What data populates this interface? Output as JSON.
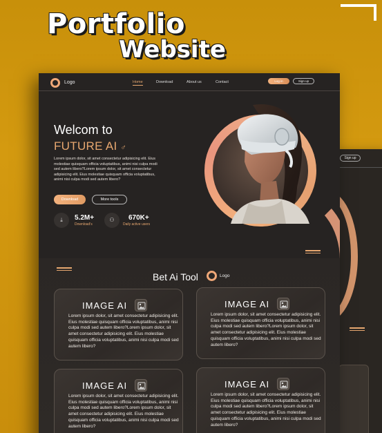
{
  "promo": {
    "title": "Portfolio",
    "subtitle": "Website"
  },
  "nav": {
    "logo": "Logo",
    "links": [
      "Home",
      "Download",
      "About us",
      "Contact"
    ],
    "login": "Log in",
    "signup": "Sign up"
  },
  "hero": {
    "title": "Welcom to",
    "accent": "FUTURE AI",
    "accent_symbol": "♂",
    "body": "Lorem ipsum dolor, sit amet consectetur adipisicing elit. Eius molestiae quisquam officia voluptatibus, animi nisi culpa modi sed autem libero?Lorem ipsum dolor, sit amet consectetur adipisicing elit. Eius molestiae quisquam officia voluptatibus, animi nisi culpa modi sed autem libero?",
    "download": "Download",
    "more": "More tools",
    "stats": [
      {
        "value": "5.2M+",
        "label": "Download's",
        "icon": "download-box-icon"
      },
      {
        "value": "670K+",
        "label": "Daily active users",
        "icon": "users-icon"
      }
    ]
  },
  "section": {
    "title": "Bet Ai Tool",
    "logo": "Logo"
  },
  "cards": [
    {
      "title": "IMAGE  AI",
      "body": "Lorem ipsum dolor, sit amet consectetur adipisicing elit. Eius molestiae quisquam officia voluptatibus, animi nisi culpa modi sed autem libero?Lorem ipsum dolor, sit amet consectetur adipisicing elit. Eius molestiae quisquam officia voluptatibus, animi nisi culpa modi sed autem libero?"
    },
    {
      "title": "IMAGE  AI",
      "body": "Lorem ipsum dolor, sit amet consectetur adipisicing elit. Eius molestiae quisquam officia voluptatibus, animi nisi culpa modi sed autem libero?Lorem ipsum dolor, sit amet consectetur adipisicing elit. Eius molestiae quisquam officia voluptatibus, animi nisi culpa modi sed autem libero?"
    },
    {
      "title": "IMAGE  AI",
      "body": "Lorem ipsum dolor, sit amet consectetur adipisicing elit. Eius molestiae quisquam officia voluptatibus, animi nisi culpa modi sed autem libero?Lorem ipsum dolor, sit amet consectetur adipisicing elit. Eius molestiae quisquam officia voluptatibus, animi nisi culpa modi sed autem libero?"
    },
    {
      "title": "IMAGE  AI",
      "body": "Lorem ipsum dolor, sit amet consectetur adipisicing elit. Eius molestiae quisquam officia voluptatibus, animi nisi culpa modi sed autem libero?Lorem ipsum dolor, sit amet consectetur adipisicing elit. Eius molestiae quisquam officia voluptatibus, animi nisi culpa modi sed autem libero?"
    }
  ],
  "back_page": {
    "signup": "Sign up"
  },
  "colors": {
    "accent": "#e8a870",
    "background": "#262322",
    "promo_bg": "#c8900a"
  }
}
